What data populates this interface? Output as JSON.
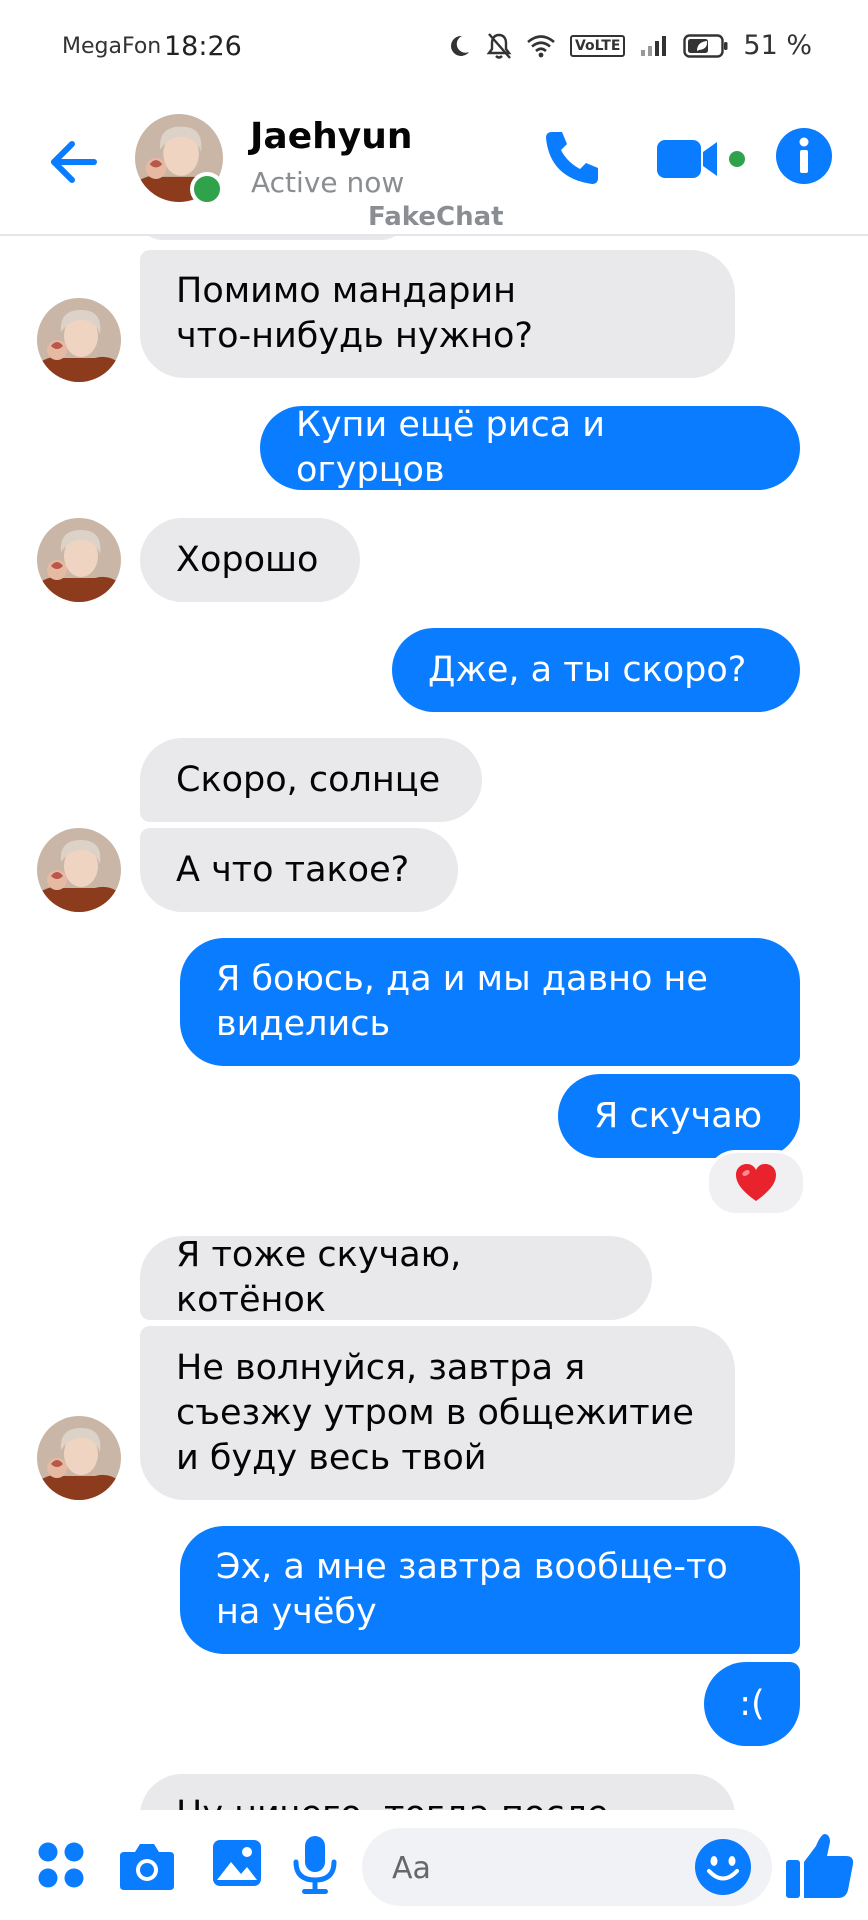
{
  "status_bar": {
    "carrier": "MegaFon",
    "time": "18:26",
    "volte": "VoLTE",
    "battery": "51 %"
  },
  "header": {
    "name": "Jaehyun",
    "status": "Active now",
    "watermark": "FakeChat"
  },
  "messages": {
    "m1": "Помимо мандарин\nчто-нибудь нужно?",
    "m2": "Купи ещё риса и огурцов",
    "m3": "Хорошо",
    "m4": "Дже, а ты скоро?",
    "m5": "Скоро, солнце",
    "m6": "А что такое?",
    "m7": "Я боюсь, да и мы давно не\nвиделись",
    "m8": "Я скучаю",
    "m9": "Я тоже скучаю, котёнок",
    "m10": "Не волнуйся, завтра я\nсъезжу утром в общежитие\nи буду весь твой",
    "m11": "Эх, а мне завтра вообще-то\nна учёбу",
    "m12": ":(",
    "m13": "Ну ничего, тогда после"
  },
  "reaction": {
    "icon": "heart-icon",
    "color": "#e8232e"
  },
  "composer": {
    "placeholder": "Aa"
  },
  "colors": {
    "accent": "#0a7cff",
    "incoming_bubble": "#e9e9eb",
    "online": "#31a24c"
  }
}
